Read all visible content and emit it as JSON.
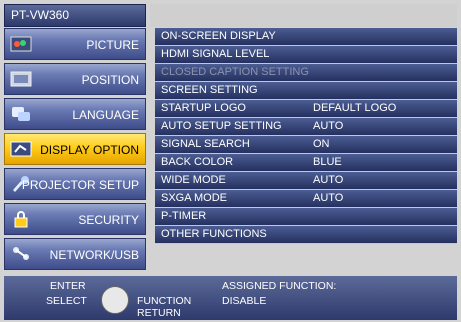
{
  "model": "PT-VW360",
  "menu": {
    "items": [
      {
        "label": "PICTURE",
        "icon": "picture-icon"
      },
      {
        "label": "POSITION",
        "icon": "position-icon"
      },
      {
        "label": "LANGUAGE",
        "icon": "language-icon"
      },
      {
        "label": "DISPLAY OPTION",
        "icon": "display-option-icon"
      },
      {
        "label": "PROJECTOR SETUP",
        "icon": "projector-setup-icon"
      },
      {
        "label": "SECURITY",
        "icon": "lock-icon"
      },
      {
        "label": "NETWORK/USB",
        "icon": "network-icon"
      }
    ],
    "active_index": 3
  },
  "submenu": {
    "rows": [
      {
        "name": "ON-SCREEN DISPLAY",
        "value": ""
      },
      {
        "name": "HDMI SIGNAL LEVEL",
        "value": ""
      },
      {
        "name": "CLOSED CAPTION SETTING",
        "value": "",
        "disabled": true
      },
      {
        "name": "SCREEN SETTING",
        "value": ""
      },
      {
        "name": "STARTUP LOGO",
        "value": "DEFAULT LOGO"
      },
      {
        "name": "AUTO SETUP SETTING",
        "value": "AUTO"
      },
      {
        "name": "SIGNAL SEARCH",
        "value": "ON"
      },
      {
        "name": "BACK COLOR",
        "value": "BLUE"
      },
      {
        "name": "WIDE MODE",
        "value": "AUTO"
      },
      {
        "name": "SXGA MODE",
        "value": "AUTO"
      },
      {
        "name": "P-TIMER",
        "value": ""
      },
      {
        "name": "OTHER FUNCTIONS",
        "value": ""
      }
    ]
  },
  "footer": {
    "enter": "ENTER",
    "select": "SELECT",
    "function": "FUNCTION",
    "return": "RETURN",
    "assigned": "ASSIGNED FUNCTION:",
    "assigned_value": "DISABLE"
  },
  "colors": {
    "active_item": "#ffcc1a",
    "menu_item": "#3e4d8a",
    "submenu_row": "#24305f"
  }
}
